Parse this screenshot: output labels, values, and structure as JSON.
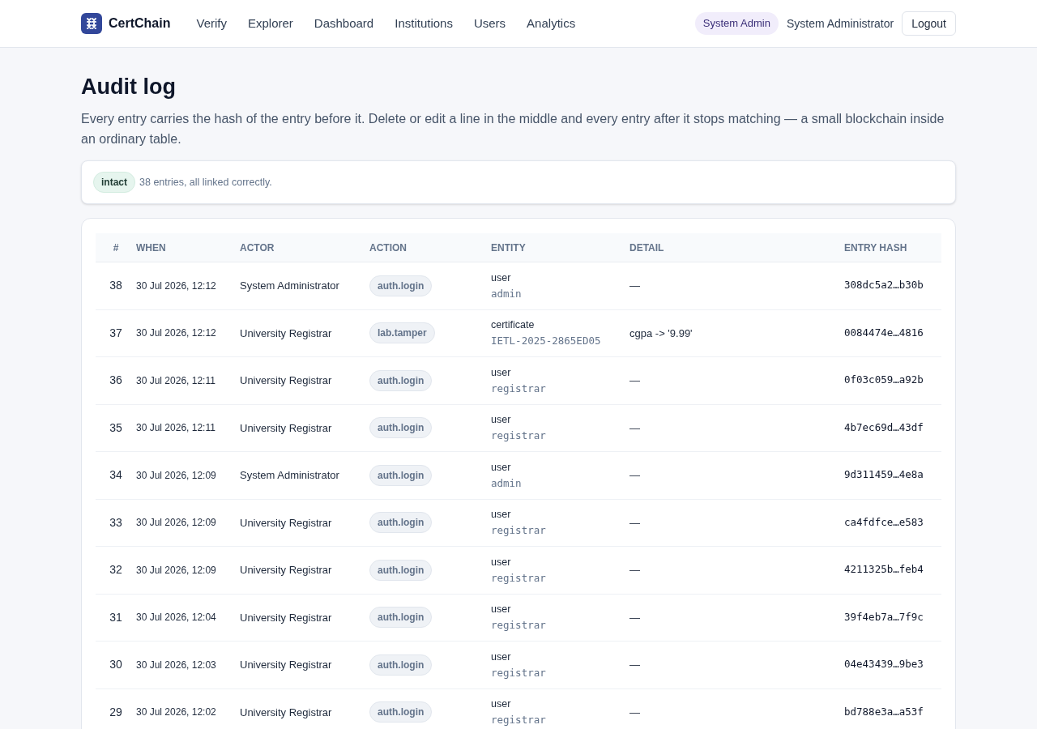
{
  "nav": {
    "brand": "CertChain",
    "links": [
      "Verify",
      "Explorer",
      "Dashboard",
      "Institutions",
      "Users",
      "Analytics"
    ],
    "role_badge": "System Admin",
    "user_name": "System Administrator",
    "logout": "Logout"
  },
  "page": {
    "title": "Audit log",
    "description": "Every entry carries the hash of the entry before it. Delete or edit a line in the middle and every entry after it stops matching — a small blockchain inside an ordinary table."
  },
  "status": {
    "badge": "intact",
    "message": "38 entries, all linked correctly."
  },
  "table": {
    "columns": [
      "#",
      "WHEN",
      "ACTOR",
      "ACTION",
      "ENTITY",
      "DETAIL",
      "ENTRY HASH"
    ],
    "rows": [
      {
        "number": "38",
        "when": "30 Jul 2026, 12:12",
        "actor": "System Administrator",
        "action": "auth.login",
        "entity_type": "user",
        "entity_id": "admin",
        "detail": "—",
        "hash": "308dc5a2…b30b"
      },
      {
        "number": "37",
        "when": "30 Jul 2026, 12:12",
        "actor": "University Registrar",
        "action": "lab.tamper",
        "entity_type": "certificate",
        "entity_id": "IETL-2025-2865ED05",
        "detail": "cgpa -> '9.99'",
        "hash": "0084474e…4816"
      },
      {
        "number": "36",
        "when": "30 Jul 2026, 12:11",
        "actor": "University Registrar",
        "action": "auth.login",
        "entity_type": "user",
        "entity_id": "registrar",
        "detail": "—",
        "hash": "0f03c059…a92b"
      },
      {
        "number": "35",
        "when": "30 Jul 2026, 12:11",
        "actor": "University Registrar",
        "action": "auth.login",
        "entity_type": "user",
        "entity_id": "registrar",
        "detail": "—",
        "hash": "4b7ec69d…43df"
      },
      {
        "number": "34",
        "when": "30 Jul 2026, 12:09",
        "actor": "System Administrator",
        "action": "auth.login",
        "entity_type": "user",
        "entity_id": "admin",
        "detail": "—",
        "hash": "9d311459…4e8a"
      },
      {
        "number": "33",
        "when": "30 Jul 2026, 12:09",
        "actor": "University Registrar",
        "action": "auth.login",
        "entity_type": "user",
        "entity_id": "registrar",
        "detail": "—",
        "hash": "ca4fdfce…e583"
      },
      {
        "number": "32",
        "when": "30 Jul 2026, 12:09",
        "actor": "University Registrar",
        "action": "auth.login",
        "entity_type": "user",
        "entity_id": "registrar",
        "detail": "—",
        "hash": "4211325b…feb4"
      },
      {
        "number": "31",
        "when": "30 Jul 2026, 12:04",
        "actor": "University Registrar",
        "action": "auth.login",
        "entity_type": "user",
        "entity_id": "registrar",
        "detail": "—",
        "hash": "39f4eb7a…7f9c"
      },
      {
        "number": "30",
        "when": "30 Jul 2026, 12:03",
        "actor": "University Registrar",
        "action": "auth.login",
        "entity_type": "user",
        "entity_id": "registrar",
        "detail": "—",
        "hash": "04e43439…9be3"
      },
      {
        "number": "29",
        "when": "30 Jul 2026, 12:02",
        "actor": "University Registrar",
        "action": "auth.login",
        "entity_type": "user",
        "entity_id": "registrar",
        "detail": "—",
        "hash": "bd788e3a…a53f"
      }
    ]
  }
}
